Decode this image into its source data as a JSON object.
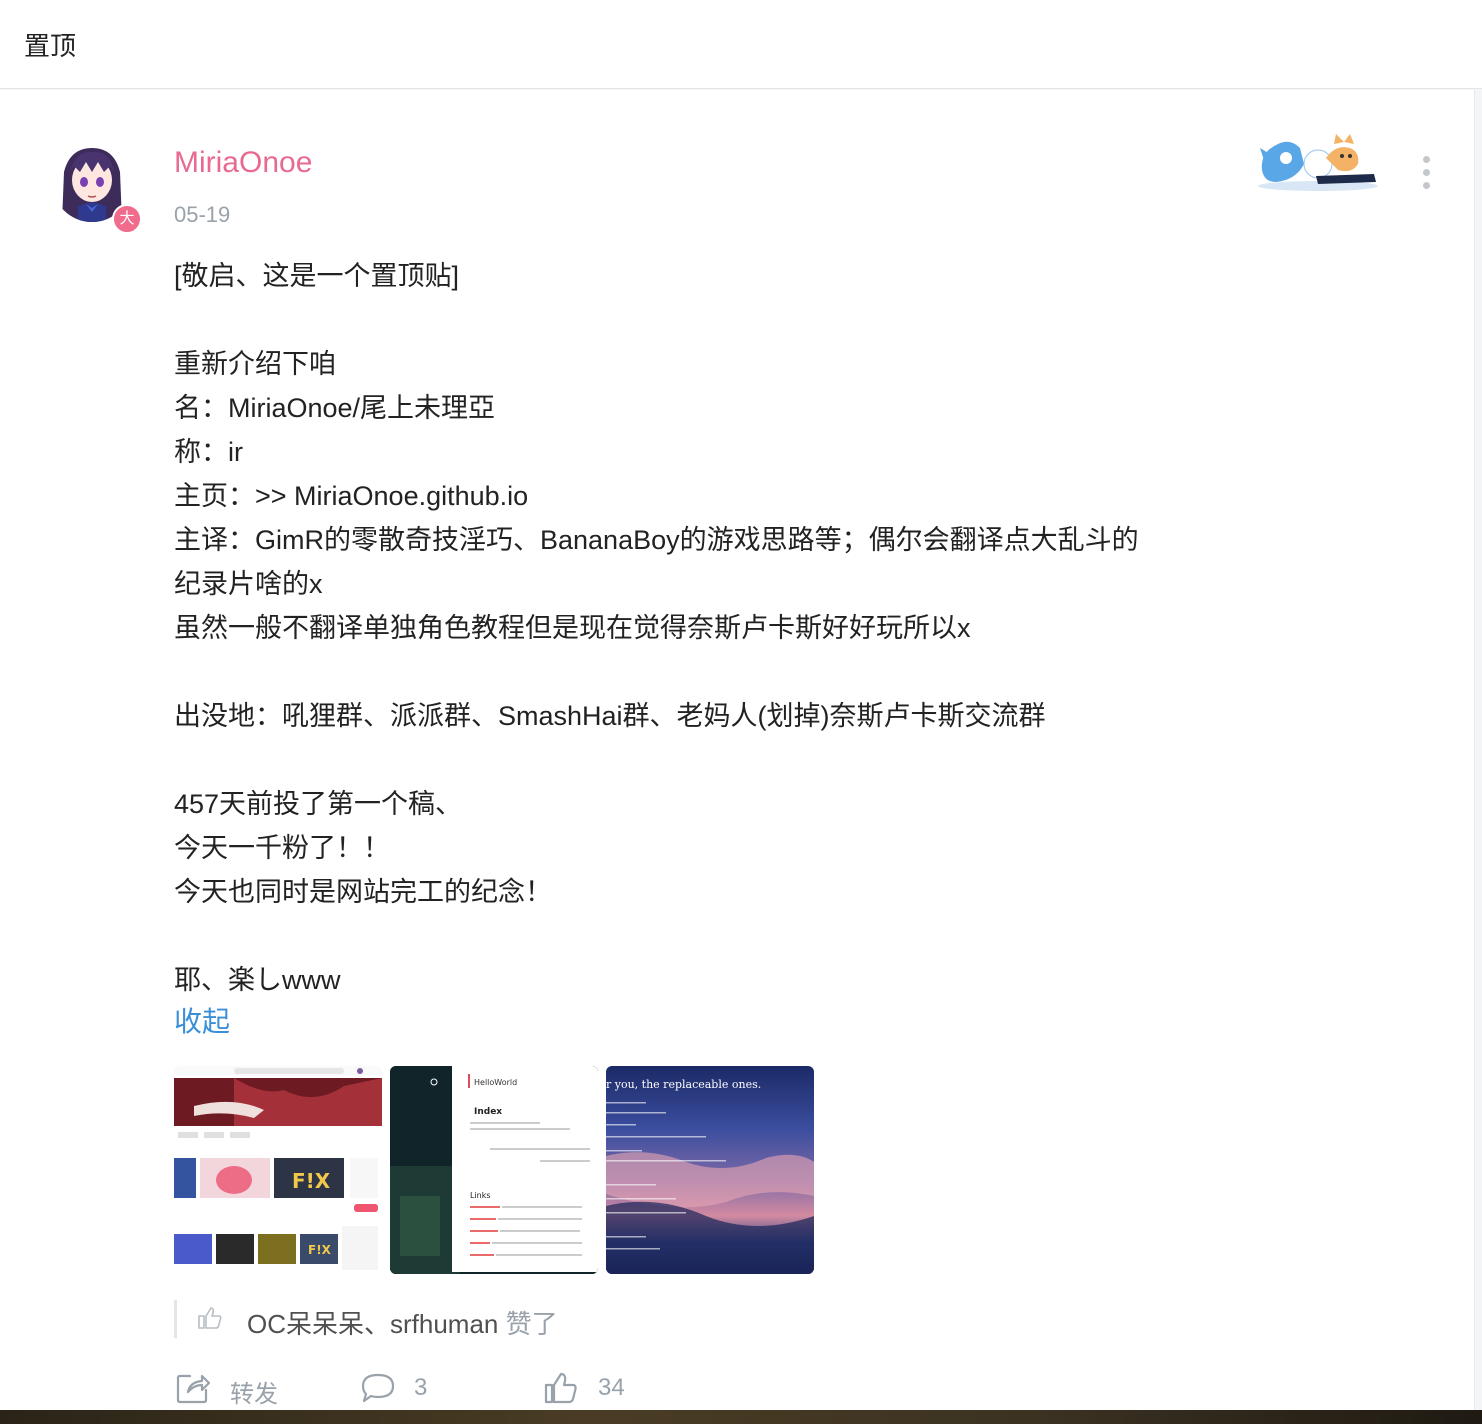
{
  "header": {
    "title": "置顶"
  },
  "post": {
    "username": "MiriaOnoe",
    "date": "05-19",
    "badge": "大",
    "body_lines": [
      "[敬启、这是一个置顶贴]",
      "",
      "重新介绍下咱",
      "名：MiriaOnoe/尾上未理亞",
      "称：ir",
      "主页：>> MiriaOnoe.github.io",
      "主译：GimR的零散奇技淫巧、BananaBoy的游戏思路等；偶尔会翻译点大乱斗的",
      "纪录片啥的x",
      "虽然一般不翻译单独角色教程但是现在觉得奈斯卢卡斯好好玩所以x",
      "",
      "出没地：吼狸群、派派群、SmashHai群、老妈人(划掉)奈斯卢卡斯交流群",
      "",
      "457天前投了第一个稿、",
      "今天一千粉了！！",
      "今天也同时是网站完工的纪念！",
      "",
      "耶、楽しwww"
    ],
    "collapse_label": "收起",
    "images": [
      {
        "name": "screenshot-video-site"
      },
      {
        "name": "screenshot-helloworld-page",
        "title": "HelloWorld",
        "heading": "Index",
        "links_heading": "Links"
      },
      {
        "name": "screenshot-sunset-page",
        "caption": "r you, the replaceable ones."
      }
    ],
    "likes": {
      "names": "OC呆呆呆、srfhuman",
      "suffix": "赞了"
    },
    "actions": {
      "repost_label": "转发",
      "comment_count": "3",
      "like_count": "34"
    }
  },
  "colors": {
    "username": "#e86a91",
    "link": "#3a8fd6",
    "muted": "#99a2aa"
  },
  "icons": [
    "more-icon",
    "thumbs-up-icon",
    "share-icon",
    "comment-icon",
    "like-icon"
  ]
}
